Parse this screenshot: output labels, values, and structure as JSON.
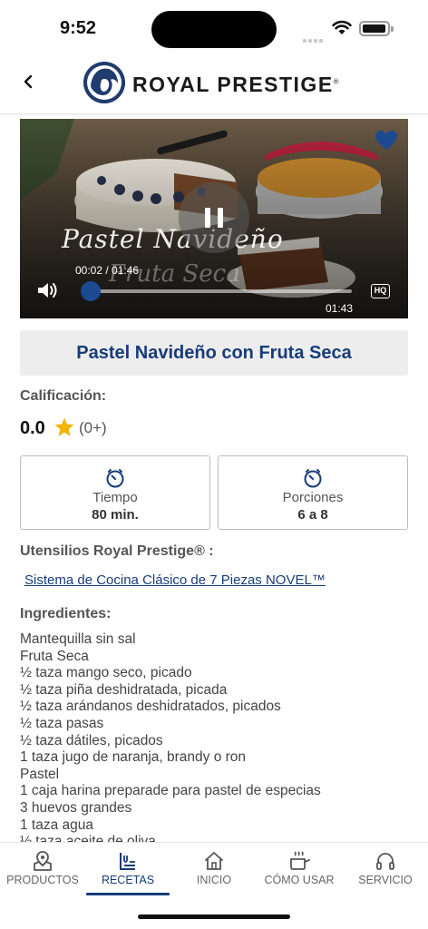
{
  "status_bar": {
    "time": "9:52"
  },
  "header": {
    "brand": "ROYAL PRESTIGE",
    "registered": "®"
  },
  "video": {
    "overlay_title": "Pastel Navideño",
    "overlay_subtitle": "Fruta Seca",
    "elapsed_overlay": "00:02 / 01:46",
    "remaining": "01:43",
    "quality_badge": "HQ",
    "progress_fraction": 0.02
  },
  "recipe": {
    "title": "Pastel Navideño con Fruta Seca",
    "rating_label": "Calificación:",
    "rating_value": "0.0",
    "rating_count": "(0+)",
    "time_label": "Tiempo",
    "time_value": "80 min.",
    "portions_label": "Porciones",
    "portions_value": "6 a 8",
    "utensils_label": "Utensilios Royal Prestige® :",
    "utensil_link": "Sistema de Cocina Clásico de 7 Piezas NOVEL™",
    "ingredients_label": "Ingredientes:",
    "ingredients": [
      "Mantequilla sin sal",
      "Fruta Seca",
      "½ taza mango seco, picado",
      "½ taza piña deshidratada, picada",
      "½ taza arándanos deshidratados, picados",
      "½ taza pasas",
      "½ taza dátiles, picados",
      "1 taza jugo de naranja, brandy o ron",
      "Pastel",
      "1 caja harina preparade para pastel de especias",
      "3 huevos grandes",
      "1 taza agua",
      "½ taza aceite de oliva"
    ]
  },
  "tabs": [
    {
      "label": "PRODUCTOS",
      "icon": "product-box-icon"
    },
    {
      "label": "RECETAS",
      "icon": "recipes-icon"
    },
    {
      "label": "INICIO",
      "icon": "home-icon"
    },
    {
      "label": "CÓMO USAR",
      "icon": "cooking-pot-icon"
    },
    {
      "label": "SERVICIO",
      "icon": "headset-icon"
    }
  ],
  "colors": {
    "brand_blue": "#173c7a",
    "star": "#f5b301",
    "heart": "#1b4a91"
  }
}
